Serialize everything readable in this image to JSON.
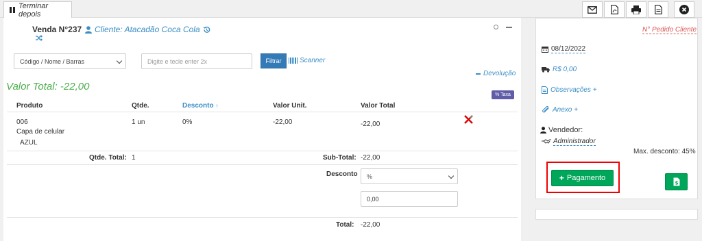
{
  "topbar": {
    "terminar_label": "Terminar depois",
    "tools": [
      "mail-icon",
      "pdf-icon",
      "print-icon",
      "document-icon",
      "close-icon"
    ]
  },
  "venda": {
    "title": "Venda N°237",
    "cliente": "Cliente: Atacadão Coca Cola"
  },
  "search": {
    "select_value": "Código / Nome / Barras",
    "input_placeholder": "Digite e tecle enter 2x",
    "filtrar_label": "Filtrar",
    "scanner_label": "Scanner"
  },
  "devolucao_label": "Devolução",
  "valor_total": "Valor Total: -22,00",
  "taxa_label": "% Taxa",
  "table": {
    "headers": {
      "produto": "Produto",
      "qtde": "Qtde.",
      "desconto": "Desconto",
      "valor_unit": "Valor Unit.",
      "valor_total": "Valor Total"
    },
    "rows": [
      {
        "code": "006",
        "name": "Capa de celular",
        "variant": "AZUL",
        "qtde": "1 un",
        "desconto": "0%",
        "valor_unit": "-22,00",
        "valor_total": "-22,00"
      }
    ]
  },
  "summary": {
    "qtde_total_label": "Qtde. Total:",
    "qtde_total_value": "1",
    "subtotal_label": "Sub-Total:",
    "subtotal_value": "-22,00",
    "desconto_label": "Desconto",
    "desconto_type": "%",
    "desconto_value": "0,00",
    "total_label": "Total:",
    "total_value": "-22,00"
  },
  "sidebar": {
    "pedido_cliente": "N° Pedido Cliente",
    "date": "08/12/2022",
    "frete": "R$ 0,00",
    "observacoes": "Observações +",
    "anexo": "Anexo +",
    "vendedor_label": "Vendedor:",
    "vendedor_name": "Administrador",
    "max_desconto": "Max. desconto: 45%",
    "pagamento_label": "Pagamento"
  },
  "colors": {
    "accent_blue": "#3a8dc5",
    "green": "#00a65a",
    "valor_total_green": "#4cae4c",
    "red": "#d9534f",
    "taxa_purple": "#605ca8",
    "highlight_red": "#ee0000"
  }
}
